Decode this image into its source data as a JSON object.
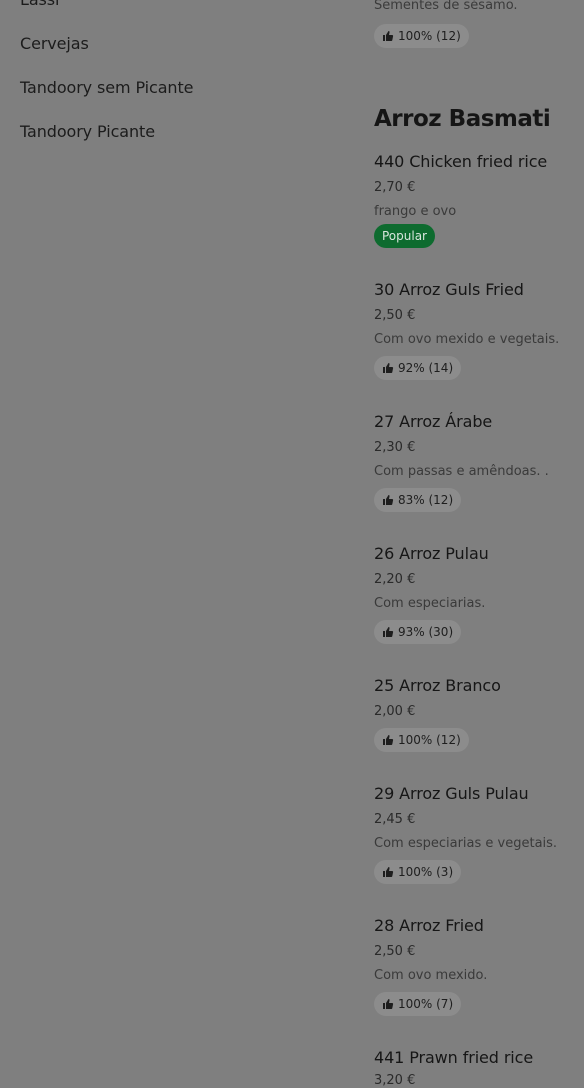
{
  "nav": {
    "items": [
      "Lassi",
      "Cervejas",
      "Tandoory sem Picante",
      "Tandoory Picante"
    ]
  },
  "top": {
    "desc": "Sementes de sésamo.",
    "rating": "100% (12)"
  },
  "section": {
    "title": "Arroz Basmati"
  },
  "items": [
    {
      "name": "440 Chicken fried rice",
      "price": "2,70 €",
      "desc": "frango e ovo",
      "badge": "Popular"
    },
    {
      "name": "30 Arroz Guls Fried",
      "price": "2,50 €",
      "desc": "Com ovo mexido e vegetais.",
      "rating": "92% (14)"
    },
    {
      "name": "27 Arroz Árabe",
      "price": "2,30 €",
      "desc": "Com passas e amêndoas. .",
      "rating": "83% (12)"
    },
    {
      "name": "26 Arroz Pulau",
      "price": "2,20 €",
      "desc": "Com especiarias.",
      "rating": "93% (30)"
    },
    {
      "name": "25 Arroz Branco",
      "price": "2,00 €",
      "rating": "100% (12)"
    },
    {
      "name": "29 Arroz Guls Pulau",
      "price": "2,45 €",
      "desc": "Com especiarias e vegetais.",
      "rating": "100% (3)"
    },
    {
      "name": "28 Arroz Fried",
      "price": "2,50 €",
      "desc": "Com ovo mexido.",
      "rating": "100% (7)"
    },
    {
      "name": "441 Prawn fried rice",
      "price": "3,20 €"
    }
  ],
  "colors": {
    "overlay_bg": "#7f7f7f",
    "badge_green": "#0e6b2f",
    "rating_pill": "#8c8c8c"
  },
  "icons": {
    "rating": "thumbs-up-icon"
  }
}
